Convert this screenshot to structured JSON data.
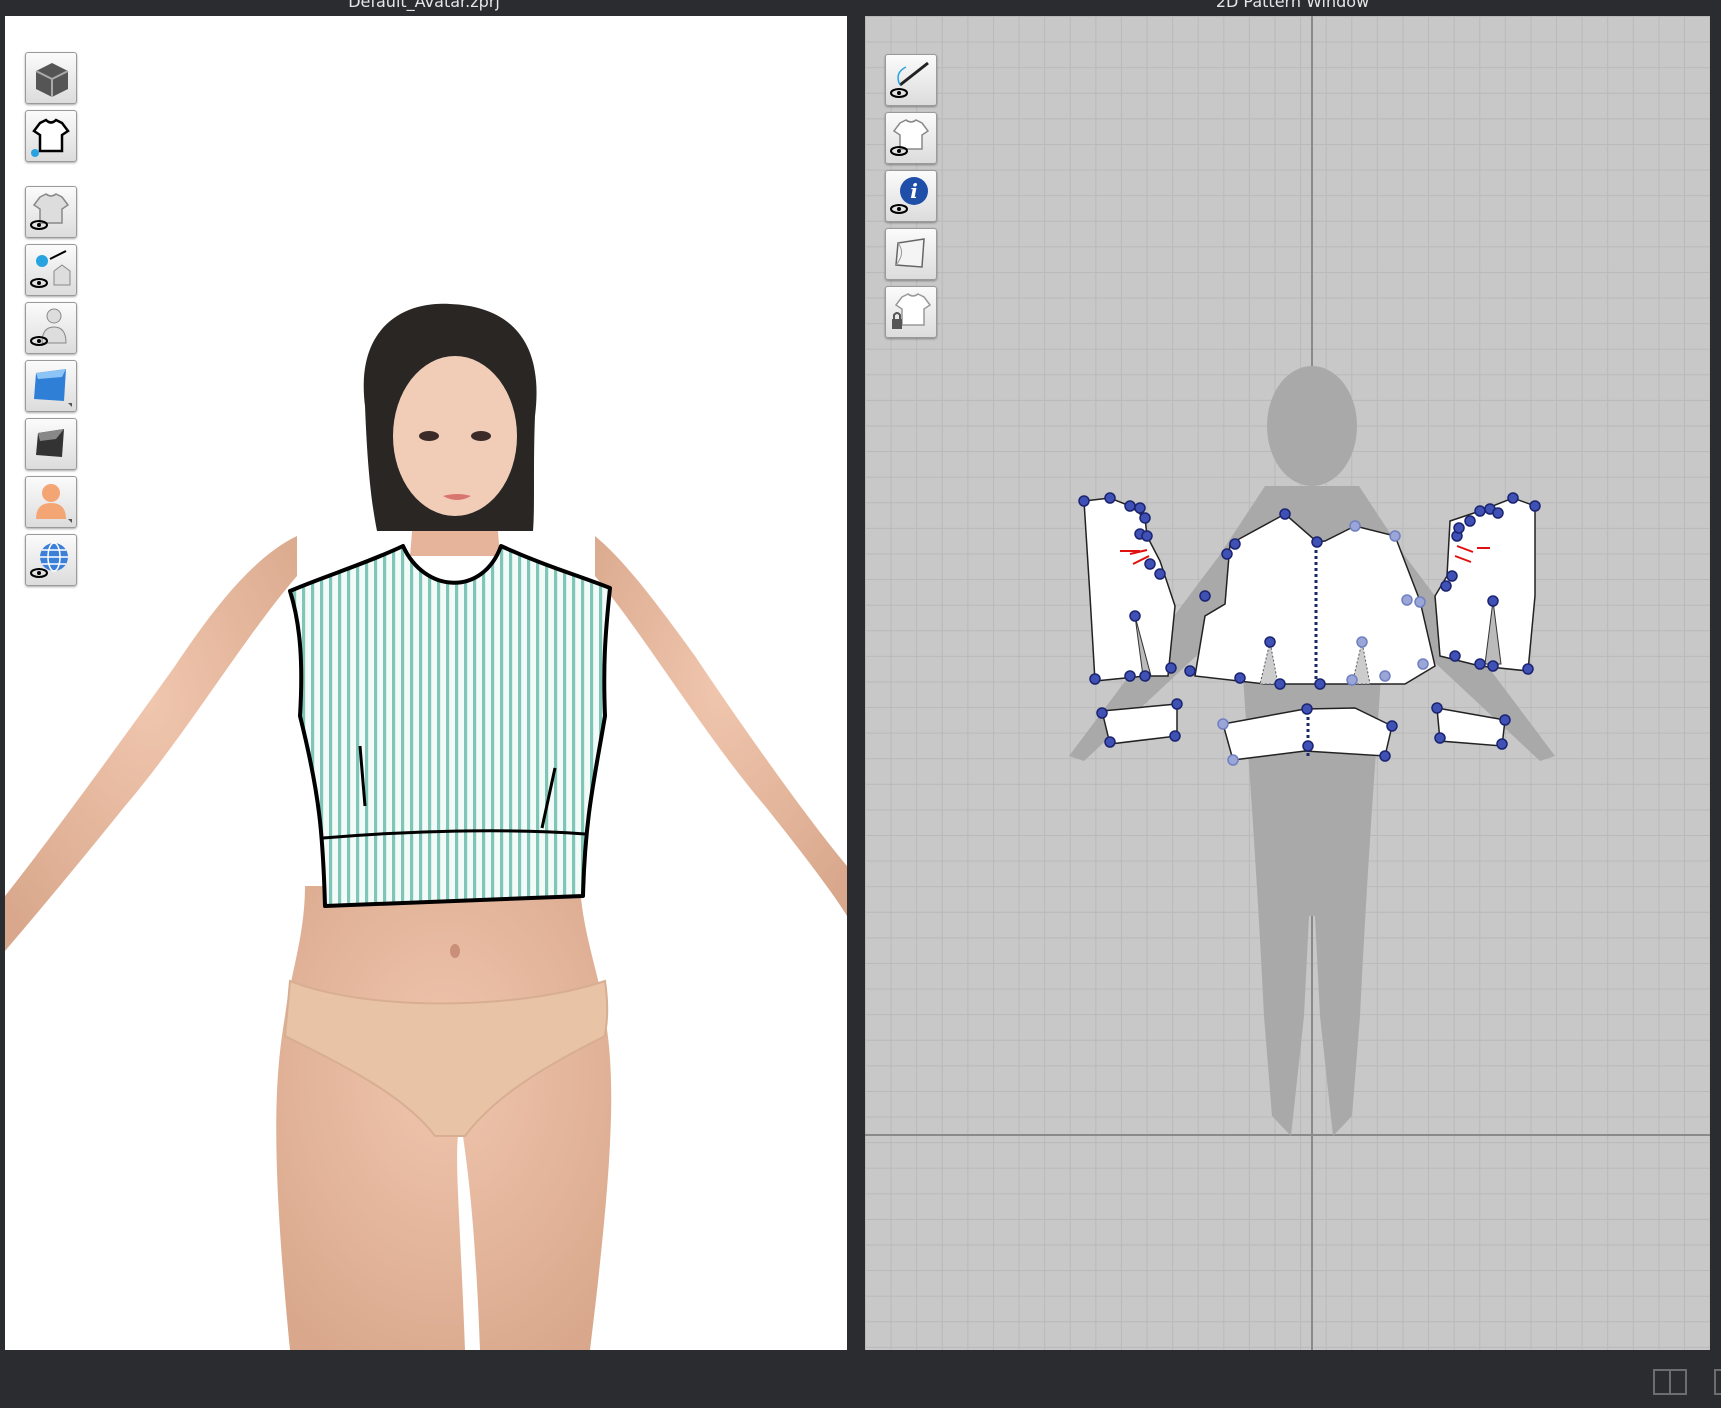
{
  "windows": {
    "view3d_title": "Default_Avatar.zprj",
    "view2d_title": "2D Pattern Window"
  },
  "toolbar3d": [
    {
      "icon": "3d-garment-cube-icon"
    },
    {
      "icon": "garment-info-shirt-icon"
    },
    {
      "icon": "show-garment-icon"
    },
    {
      "icon": "show-trims-icon"
    },
    {
      "icon": "show-avatar-icon"
    },
    {
      "icon": "texture-display-icon"
    },
    {
      "icon": "fabric-render-icon"
    },
    {
      "icon": "avatar-skin-icon"
    },
    {
      "icon": "world-globe-icon"
    }
  ],
  "toolbar2d": [
    {
      "icon": "show-needle-sewing-icon"
    },
    {
      "icon": "show-pattern-shirt-icon"
    },
    {
      "icon": "show-info-icon"
    },
    {
      "icon": "fabric-texture-icon"
    },
    {
      "icon": "lock-pattern-icon"
    }
  ],
  "colors": {
    "background": "#2b2c2f",
    "grid": "#c8c8c8",
    "pattern_point": "#3f51b5",
    "stripe": "#7fc6b8",
    "skin": "#e8b9a0"
  }
}
